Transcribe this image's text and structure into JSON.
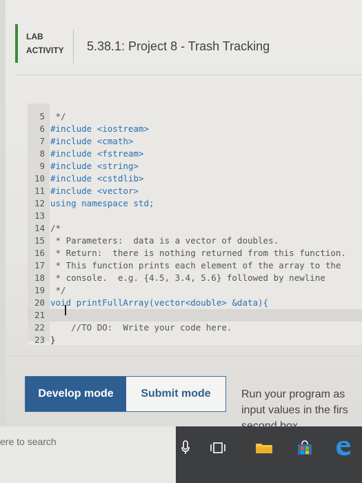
{
  "header": {
    "lab_line1": "LAB",
    "lab_line2": "ACTIVITY",
    "title": "5.38.1: Project 8 - Trash Tracking"
  },
  "editor": {
    "lines": [
      {
        "n": "5",
        "text": " */"
      },
      {
        "n": "6",
        "text": "#include <iostream>"
      },
      {
        "n": "7",
        "text": "#include <cmath>"
      },
      {
        "n": "8",
        "text": "#include <fstream>"
      },
      {
        "n": "9",
        "text": "#include <string>"
      },
      {
        "n": "10",
        "text": "#include <cstdlib>"
      },
      {
        "n": "11",
        "text": "#include <vector>"
      },
      {
        "n": "12",
        "text": "using namespace std;"
      },
      {
        "n": "13",
        "text": ""
      },
      {
        "n": "14",
        "text": "/*"
      },
      {
        "n": "15",
        "text": " * Parameters:  data is a vector of doubles."
      },
      {
        "n": "16",
        "text": " * Return:  there is nothing returned from this function."
      },
      {
        "n": "17",
        "text": " * This function prints each element of the array to the"
      },
      {
        "n": "18",
        "text": " * console.  e.g. {4.5, 3.4, 5.6} followed by newline"
      },
      {
        "n": "19",
        "text": " */"
      },
      {
        "n": "20",
        "text": "void printFullArray(vector<double> &data){"
      },
      {
        "n": "21",
        "text": ""
      },
      {
        "n": "22",
        "text": "    //TO DO:  Write your code here."
      },
      {
        "n": "23",
        "text": "}"
      }
    ]
  },
  "modes": {
    "develop": "Develop mode",
    "submit": "Submit mode"
  },
  "run_hint": {
    "line1": "Run your program as",
    "line2": "input values in the firs",
    "line3": "second box."
  },
  "taskbar": {
    "search_text": "ere to search"
  },
  "colors": {
    "accent": "#2f5f92",
    "lab_bar": "#3b8a3e",
    "keyword": "#2b6fb5"
  }
}
